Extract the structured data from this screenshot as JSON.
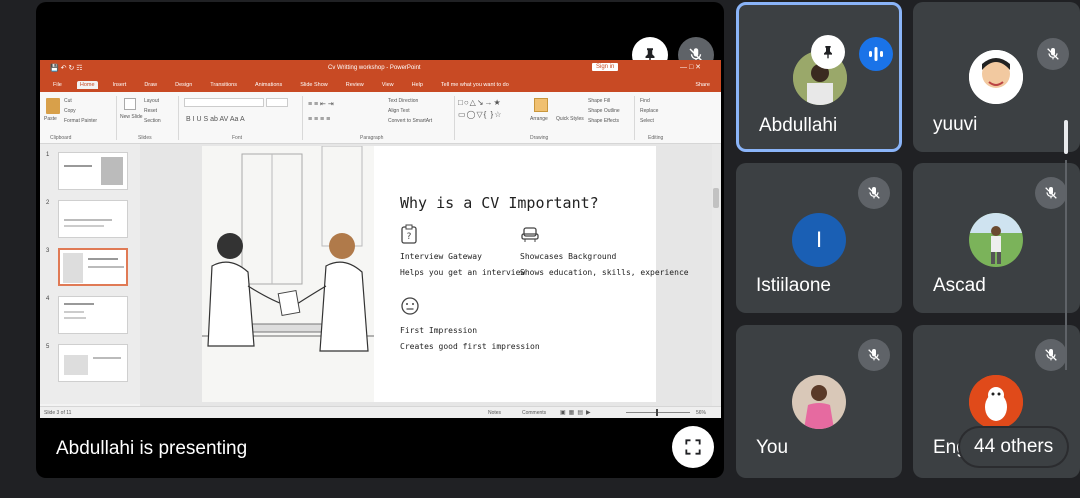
{
  "presenter_banner": "Abdullahi is presenting",
  "ppt": {
    "window_title": "Cv Writting workshop - PowerPoint",
    "sign_in": "Sign in",
    "tabs": [
      "File",
      "Home",
      "Insert",
      "Draw",
      "Design",
      "Transitions",
      "Animations",
      "Slide Show",
      "Review",
      "View",
      "Help"
    ],
    "tell_me": "Tell me what you want to do",
    "share": "Share",
    "ribbon": {
      "paste": "Paste",
      "cut": "Cut",
      "copy": "Copy",
      "format_painter": "Format Painter",
      "new_slide": "New Slide",
      "layout": "Layout",
      "reset": "Reset",
      "section": "Section",
      "text_direction": "Text Direction",
      "align_text": "Align Text",
      "convert_smartart": "Convert to SmartArt",
      "arrange": "Arrange",
      "quick_styles": "Quick Styles",
      "shape_fill": "Shape Fill",
      "shape_outline": "Shape Outline",
      "shape_effects": "Shape Effects",
      "find": "Find",
      "replace": "Replace",
      "select": "Select",
      "groups": [
        "Clipboard",
        "Slides",
        "Font",
        "Paragraph",
        "Drawing",
        "Editing"
      ]
    },
    "thumb_numbers": [
      "1",
      "2",
      "3",
      "4",
      "5"
    ],
    "slide": {
      "title": "Why is a CV Important?",
      "items": [
        {
          "heading": "Interview Gateway",
          "desc": "Helps you get an interview"
        },
        {
          "heading": "Showcases Background",
          "desc": "Shows education, skills, experience"
        },
        {
          "heading": "First Impression",
          "desc": "Creates good first impression"
        }
      ]
    },
    "status_left": "Slide 3 of 11",
    "notes": "Notes",
    "comments": "Comments",
    "zoom": "56%"
  },
  "participants": [
    {
      "name": "Abdullahi",
      "muted": false,
      "speaking": true
    },
    {
      "name": "yuuvi",
      "muted": true
    },
    {
      "name": "Istiilaone",
      "muted": true,
      "initial": "I",
      "avatar_color": "#1a5fb4"
    },
    {
      "name": "Ascad",
      "muted": true
    },
    {
      "name": "You",
      "muted": true
    },
    {
      "name": "Eng",
      "muted": true
    }
  ],
  "others": "44 others",
  "colors": {
    "accent": "#8ab4f8",
    "ppt_orange": "#c84a24",
    "tile": "#3c4043",
    "bg": "#202124"
  }
}
